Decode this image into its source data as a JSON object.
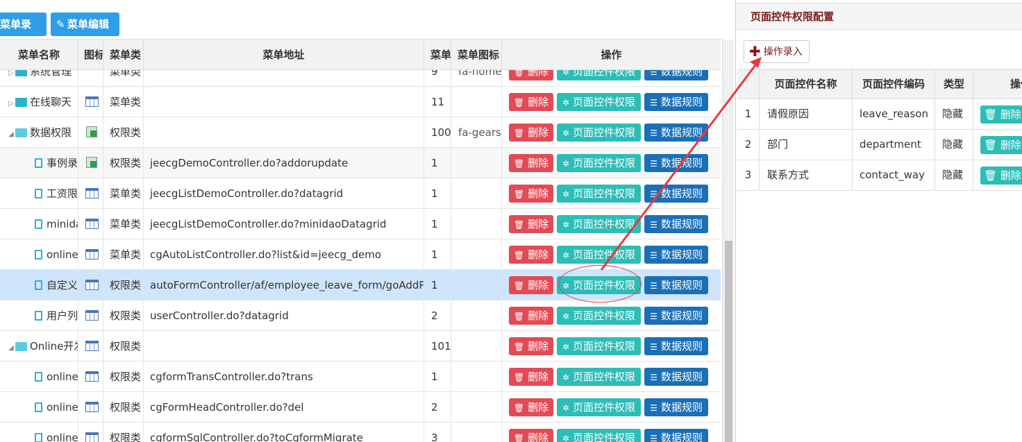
{
  "toolbar": {
    "add_menu": "菜单录入",
    "edit_menu": "菜单编辑"
  },
  "table": {
    "headers": [
      "菜单名称",
      "图标",
      "菜单类",
      "菜单地址",
      "菜单",
      "菜单图标",
      "操作"
    ],
    "rows": [
      {
        "name": "系统管理",
        "indent": 1,
        "kind": "folder",
        "icon": "users-icon",
        "type": "菜单类",
        "url": "",
        "order": "9",
        "menu_icon": "fa-home"
      },
      {
        "name": "在线聊天",
        "indent": 1,
        "kind": "folder",
        "icon": "grid-icon",
        "type": "菜单类",
        "url": "",
        "order": "11",
        "menu_icon": ""
      },
      {
        "name": "数据权限",
        "indent": 1,
        "kind": "folder-open",
        "icon": "permission-icon",
        "type": "权限类",
        "url": "",
        "order": "100",
        "menu_icon": "fa-gears"
      },
      {
        "name": "事例录",
        "indent": 2,
        "kind": "doc",
        "icon": "permission-icon",
        "type": "权限类",
        "url": "jeecgDemoController.do?addorupdate",
        "order": "1",
        "menu_icon": ""
      },
      {
        "name": "工资限",
        "indent": 2,
        "kind": "doc",
        "icon": "grid-icon",
        "type": "菜单类",
        "url": "jeecgListDemoController.do?datagrid",
        "order": "1",
        "menu_icon": ""
      },
      {
        "name": "minida",
        "indent": 2,
        "kind": "doc",
        "icon": "grid-icon",
        "type": "菜单类",
        "url": "jeecgListDemoController.do?minidaoDatagrid",
        "order": "1",
        "menu_icon": ""
      },
      {
        "name": "online",
        "indent": 2,
        "kind": "doc",
        "icon": "grid-icon",
        "type": "菜单类",
        "url": "cgAutoListController.do?list&id=jeecg_demo",
        "order": "1",
        "menu_icon": ""
      },
      {
        "name": "自定义",
        "indent": 2,
        "kind": "doc",
        "icon": "grid-icon",
        "type": "权限类",
        "url": "autoFormController/af/employee_leave_form/goAddPa",
        "order": "1",
        "menu_icon": ""
      },
      {
        "name": "用户列",
        "indent": 2,
        "kind": "doc",
        "icon": "grid-icon",
        "type": "权限类",
        "url": "userController.do?datagrid",
        "order": "2",
        "menu_icon": ""
      },
      {
        "name": "Online开发",
        "indent": 1,
        "kind": "folder-open",
        "icon": "grid-icon",
        "type": "权限类",
        "url": "",
        "order": "101",
        "menu_icon": ""
      },
      {
        "name": "online",
        "indent": 2,
        "kind": "doc",
        "icon": "grid-icon",
        "type": "权限类",
        "url": "cgformTransController.do?trans",
        "order": "1",
        "menu_icon": ""
      },
      {
        "name": "online",
        "indent": 2,
        "kind": "doc",
        "icon": "grid-icon",
        "type": "权限类",
        "url": "cgFormHeadController.do?del",
        "order": "2",
        "menu_icon": ""
      },
      {
        "name": "online",
        "indent": 2,
        "kind": "doc",
        "icon": "grid-icon",
        "type": "权限类",
        "url": "cgformSqlController.do?toCgformMigrate",
        "order": "3",
        "menu_icon": ""
      }
    ],
    "ops": {
      "delete": "删除",
      "page_control": "页面控件权限",
      "data_rule": "数据规则"
    }
  },
  "right_panel": {
    "title": "页面控件权限配置",
    "add_button": "操作录入",
    "headers": [
      "",
      "页面控件名称",
      "页面控件编码",
      "类型",
      "操作"
    ],
    "rows": [
      {
        "no": "1",
        "name": "请假原因",
        "code": "leave_reason",
        "type": "隐藏",
        "action": "删除"
      },
      {
        "no": "2",
        "name": "部门",
        "code": "department",
        "type": "隐藏",
        "action": "删除"
      },
      {
        "no": "3",
        "name": "联系方式",
        "code": "contact_way",
        "type": "隐藏",
        "action": "删除"
      }
    ]
  },
  "colors": {
    "primary": "#2f9ee8",
    "danger": "#e24b55",
    "teal": "#2dbdb7",
    "navy": "#1a6fb6",
    "annotation": "#e04040",
    "selected": "#cfe5fb"
  }
}
